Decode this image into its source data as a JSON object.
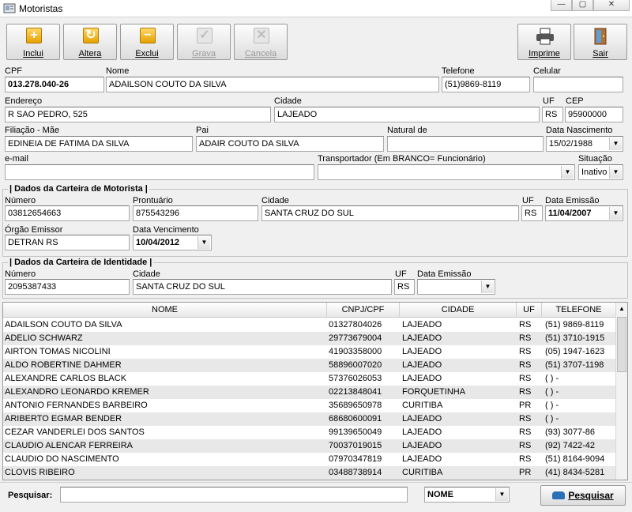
{
  "window": {
    "title": "Motoristas",
    "min": "—",
    "max": "▢",
    "close": "✕"
  },
  "toolbar": {
    "incluir": "Inclui",
    "alterar": "Altera",
    "excluir": "Exclui",
    "gravar": "Grava",
    "cancelar": "Cancela",
    "imprimir": "Imprime",
    "sair": "Sair"
  },
  "form": {
    "cpf_label": "CPF",
    "cpf": "013.278.040-26",
    "nome_label": "Nome",
    "nome": "ADAILSON COUTO DA SILVA",
    "telefone_label": "Telefone",
    "telefone": "(51)9869-8119",
    "celular_label": "Celular",
    "celular": "",
    "endereco_label": "Endereço",
    "endereco": "R SAO PEDRO, 525",
    "cidade_label": "Cidade",
    "cidade": "LAJEADO",
    "uf_label": "UF",
    "uf": "RS",
    "cep_label": "CEP",
    "cep": "95900000",
    "mae_label": "Filiação - Mãe",
    "mae": "EDINEIA DE FATIMA DA SILVA",
    "pai_label": "Pai",
    "pai": "ADAIR COUTO DA SILVA",
    "natural_label": "Natural de",
    "natural": "",
    "nasc_label": "Data Nascimento",
    "nasc": "15/02/1988",
    "email_label": "e-mail",
    "email": "",
    "transp_label": "Transportador (Em BRANCO= Funcionário)",
    "transp": "",
    "situacao_label": "Situação",
    "situacao": "Inativo"
  },
  "cnh": {
    "title": "| Dados da Carteira de Motorista |",
    "numero_label": "Número",
    "numero": "03812654663",
    "prontuario_label": "Prontuário",
    "prontuario": "875543296",
    "cidade_label": "Cidade",
    "cidade": "SANTA CRUZ DO SUL",
    "uf_label": "UF",
    "uf": "RS",
    "emissao_label": "Data Emissão",
    "emissao": "11/04/2007",
    "orgao_label": "Órgão Emissor",
    "orgao": "DETRAN RS",
    "venc_label": "Data Vencimento",
    "venc": "10/04/2012"
  },
  "rg": {
    "title": "| Dados da Carteira de Identidade |",
    "numero_label": "Número",
    "numero": "2095387433",
    "cidade_label": "Cidade",
    "cidade": "SANTA CRUZ DO SUL",
    "uf_label": "UF",
    "uf": "RS",
    "emissao_label": "Data Emissão",
    "emissao": ""
  },
  "table": {
    "headers": [
      "NOME",
      "CNPJ/CPF",
      "CIDADE",
      "UF",
      "TELEFONE"
    ],
    "rows": [
      [
        "ADAILSON COUTO DA SILVA",
        "01327804026",
        "LAJEADO",
        "RS",
        "(51) 9869-8119"
      ],
      [
        "ADELIO SCHWARZ",
        "29773679004",
        "LAJEADO",
        "RS",
        "(51) 3710-1915"
      ],
      [
        "AIRTON TOMAS NICOLINI",
        "41903358000",
        "LAJEADO",
        "RS",
        "(05) 1947-1623"
      ],
      [
        "ALDO ROBERTINE DAHMER",
        "58896007020",
        "LAJEADO",
        "RS",
        "(51) 3707-1198"
      ],
      [
        "ALEXANDRE CARLOS BLACK",
        "57376026053",
        "LAJEADO",
        "RS",
        "(  )    -"
      ],
      [
        "ALEXANDRO LEONARDO KREMER",
        "02213848041",
        "FORQUETINHA",
        "RS",
        "(  )    -"
      ],
      [
        "ANTONIO FERNANDES BARBEIRO",
        "35689650978",
        "CURITIBA",
        "PR",
        "(  )    -"
      ],
      [
        "ARIBERTO EGMAR BENDER",
        "68680600091",
        "LAJEADO",
        "RS",
        "(  )    -"
      ],
      [
        "CEZAR VANDERLEI DOS SANTOS",
        "99139650049",
        "LAJEADO",
        "RS",
        "(93) 3077-86"
      ],
      [
        "CLAUDIO ALENCAR FERREIRA",
        "70037019015",
        "LAJEADO",
        "RS",
        "(92) 7422-42"
      ],
      [
        "CLAUDIO DO NASCIMENTO",
        "07970347819",
        "LAJEADO",
        "RS",
        "(51) 8164-9094"
      ],
      [
        "CLOVIS RIBEIRO",
        "03488738914",
        "CURITIBA",
        "PR",
        "(41) 8434-5281"
      ]
    ]
  },
  "search": {
    "label": "Pesquisar:",
    "value": "",
    "field": "NOME",
    "button": "Pesquisar"
  },
  "colors": {
    "accent": "#e6a100",
    "row_alt": "#e8e8e8"
  }
}
